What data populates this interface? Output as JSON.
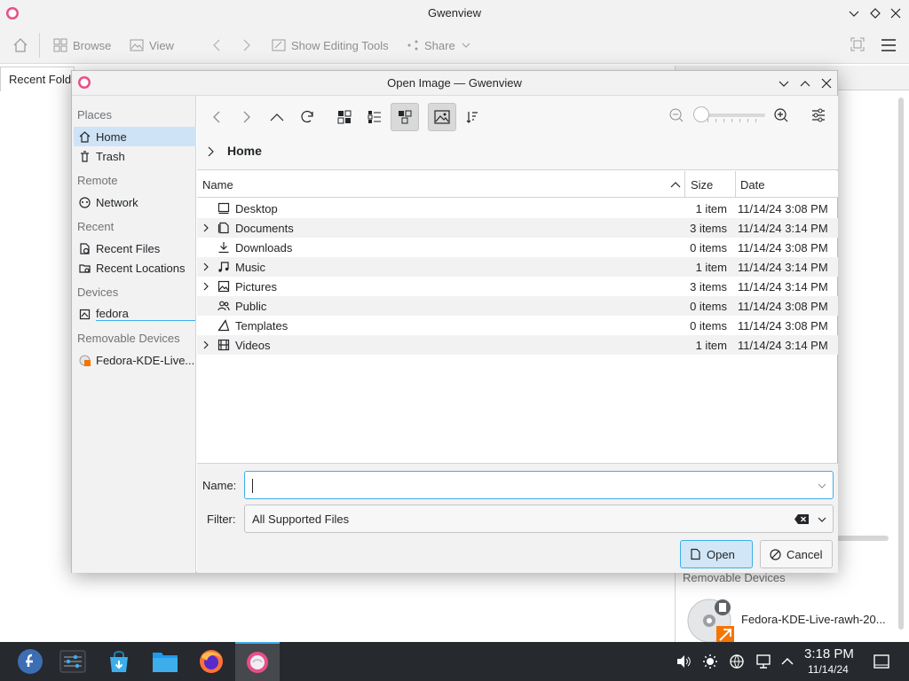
{
  "main": {
    "title": "Gwenview",
    "toolbar": {
      "browse": "Browse",
      "view": "View",
      "editing": "Show Editing Tools",
      "share": "Share"
    },
    "tab": "Recent Fold",
    "right_panel": {
      "removable_header": "Removable Devices",
      "device_label": "Fedora-KDE-Live-rawh-20..."
    }
  },
  "dialog": {
    "title": "Open Image — Gwenview",
    "places": {
      "sections": [
        {
          "header": "Places",
          "items": [
            {
              "label": "Home",
              "icon": "home-icon",
              "selected": true
            },
            {
              "label": "Trash",
              "icon": "trash-icon"
            }
          ]
        },
        {
          "header": "Remote",
          "items": [
            {
              "label": "Network",
              "icon": "network-icon"
            }
          ]
        },
        {
          "header": "Recent",
          "items": [
            {
              "label": "Recent Files",
              "icon": "recent-files-icon"
            },
            {
              "label": "Recent Locations",
              "icon": "recent-locations-icon"
            }
          ]
        },
        {
          "header": "Devices",
          "items": [
            {
              "label": "fedora",
              "icon": "drive-icon"
            }
          ]
        },
        {
          "header": "Removable Devices",
          "items": [
            {
              "label": "Fedora-KDE-Live...",
              "icon": "optical-disc-icon"
            }
          ]
        }
      ]
    },
    "breadcrumb": "Home",
    "columns": {
      "name": "Name",
      "size": "Size",
      "date": "Date"
    },
    "files": [
      {
        "name": "Desktop",
        "size": "1 item",
        "date": "11/14/24 3:08 PM",
        "icon": "desktop-icon",
        "expandable": false
      },
      {
        "name": "Documents",
        "size": "3 items",
        "date": "11/14/24 3:14 PM",
        "icon": "documents-icon",
        "expandable": true
      },
      {
        "name": "Downloads",
        "size": "0 items",
        "date": "11/14/24 3:08 PM",
        "icon": "downloads-icon",
        "expandable": false
      },
      {
        "name": "Music",
        "size": "1 item",
        "date": "11/14/24 3:14 PM",
        "icon": "music-icon",
        "expandable": true
      },
      {
        "name": "Pictures",
        "size": "3 items",
        "date": "11/14/24 3:14 PM",
        "icon": "pictures-icon",
        "expandable": true
      },
      {
        "name": "Public",
        "size": "0 items",
        "date": "11/14/24 3:08 PM",
        "icon": "public-icon",
        "expandable": false
      },
      {
        "name": "Templates",
        "size": "0 items",
        "date": "11/14/24 3:08 PM",
        "icon": "templates-icon",
        "expandable": false
      },
      {
        "name": "Videos",
        "size": "1 item",
        "date": "11/14/24 3:14 PM",
        "icon": "videos-icon",
        "expandable": true
      }
    ],
    "name_label": "Name:",
    "name_value": "",
    "filter_label": "Filter:",
    "filter_value": "All Supported Files",
    "open_label": "Open",
    "cancel_label": "Cancel"
  },
  "taskbar": {
    "time": "3:18 PM",
    "date": "11/14/24"
  },
  "colors": {
    "accent": "#3daee9",
    "selection": "#cfe3f6",
    "taskbar": "#26292d"
  }
}
